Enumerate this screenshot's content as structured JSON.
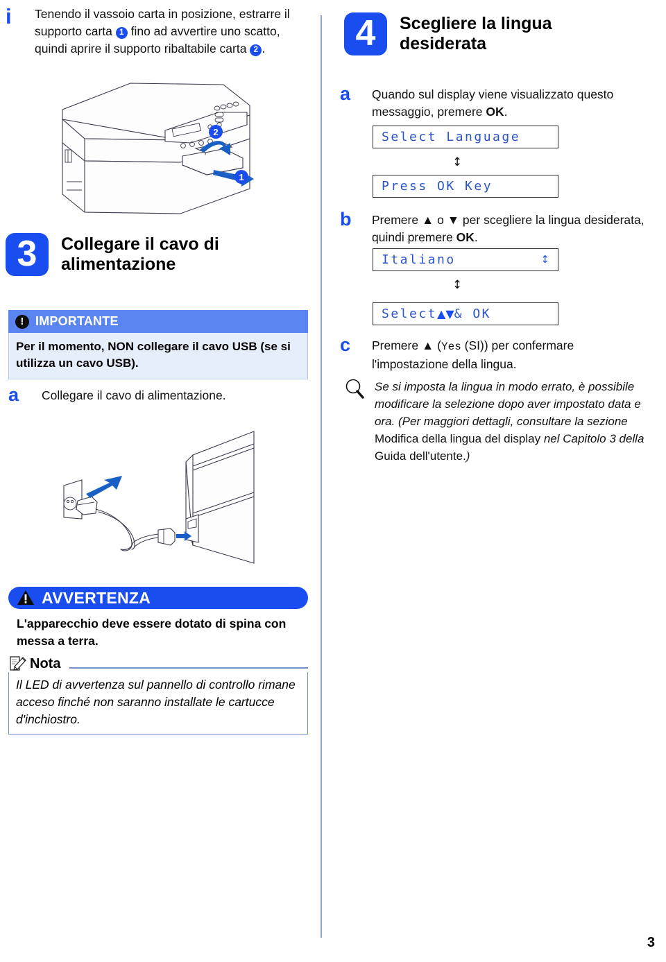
{
  "page": {
    "number": "3",
    "language": "it"
  },
  "tip_top": {
    "icon": "info-i-icon",
    "text_part1": "Tenendo il vassoio carta in posizione, estrarre il supporto carta ",
    "badge1": "1",
    "text_part2": " fino ad avvertire uno scatto, quindi aprire il supporto ribaltabile carta ",
    "badge2": "2",
    "text_part3": "."
  },
  "printer_illustration": {
    "name": "printer-tray-illustration",
    "callout_1": "1",
    "callout_2": "2"
  },
  "step3": {
    "number": "3",
    "title": "Collegare il cavo di alimentazione",
    "important": {
      "icon": "exclamation-icon",
      "label": "IMPORTANTE",
      "body": "Per il momento, NON collegare il cavo USB (se si utilizza un cavo USB)."
    },
    "sub_a": {
      "letter": "a",
      "text": "Collegare il cavo di alimentazione."
    }
  },
  "power_illustration": {
    "name": "power-cord-outlet-illustration"
  },
  "warning": {
    "icon": "warning-triangle-icon",
    "label": "AVVERTENZA",
    "body": "L'apparecchio deve essere dotato di spina con messa a terra."
  },
  "nota": {
    "icon": "note-pencil-icon",
    "label": "Nota",
    "body": "Il LED di avvertenza sul pannello di controllo rimane acceso finché non saranno installate le cartucce d'inchiostro."
  },
  "step4": {
    "number": "4",
    "title": "Scegliere la lingua desiderata",
    "sub_a": {
      "letter": "a",
      "text_pre": "Quando sul display viene visualizzato questo messaggio, premere ",
      "text_bold": "OK",
      "text_post": ".",
      "lcd_1": "Select Language",
      "connector": "↕",
      "lcd_2": "Press OK Key"
    },
    "sub_b": {
      "letter": "b",
      "text_pre": "Premere ▲ o ▼ per scegliere la lingua desiderata, quindi premere ",
      "text_bold": "OK",
      "text_post": ".",
      "lcd_1": "Italiano",
      "lcd_1_arrows": "↕",
      "connector": "↕",
      "lcd_2_pre": "Select ",
      "lcd_2_arrows": "▲▼",
      "lcd_2_post": " & OK"
    },
    "sub_c": {
      "letter": "c",
      "text_pre": "Premere ▲ (",
      "text_mono": "Yes",
      "text_mid": " (SI)) per confermare l'impostazione della lingua.",
      "tip_icon": "magnifier-icon",
      "tip_text_1": "Se si imposta la lingua in modo errato, è possibile modificare la selezione dopo aver impostato data e ora. (Per maggiori dettagli, consultare la sezione ",
      "tip_text_upright_1": "Modifica della lingua del display",
      "tip_text_2": " nel Capitolo 3 della ",
      "tip_text_upright_2": "Guida dell'utente.",
      "tip_text_3": ")"
    }
  },
  "colors": {
    "brand_blue": "#1a4df0",
    "header_blue": "#5a84ef",
    "callout_bg": "#e7eefb",
    "callout_border": "#b9ccea",
    "lcd_text": "#2b55c8",
    "divider": "#8fa7c4"
  }
}
